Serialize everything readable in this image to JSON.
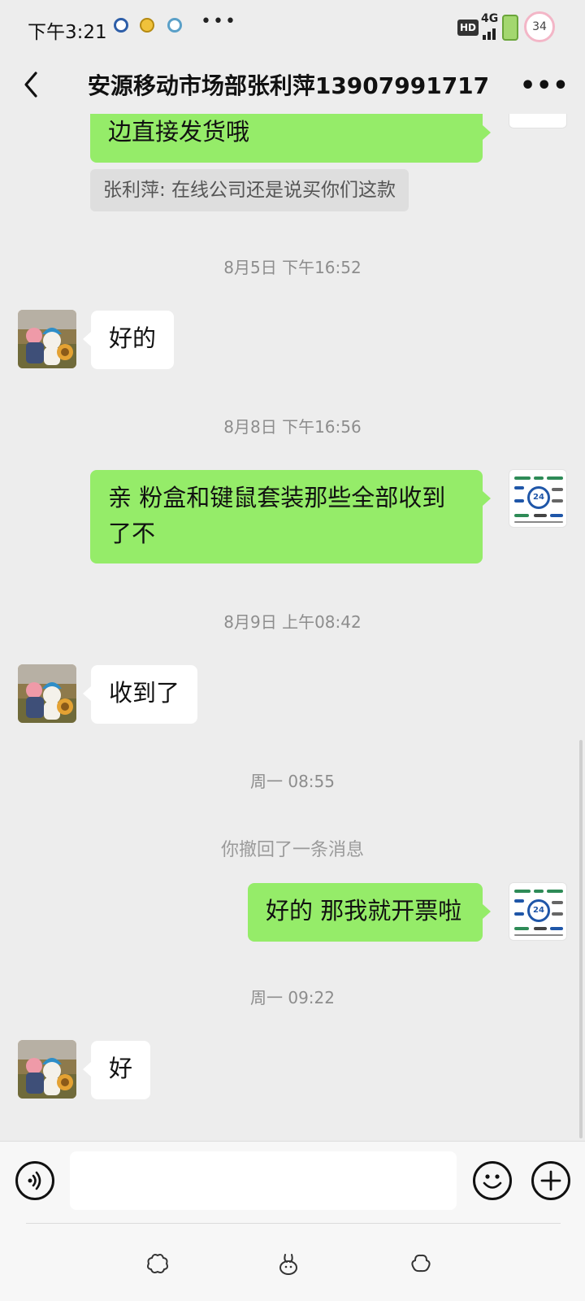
{
  "status_bar": {
    "time": "下午3:21",
    "hd_label": "HD",
    "network_label": "4G",
    "notification_count": "34"
  },
  "title_bar": {
    "title": "安源移动市场部张利萍13907991717",
    "more_glyph": "•••"
  },
  "messages": [
    {
      "type": "text",
      "side": "out",
      "text": "边直接发货哦"
    },
    {
      "type": "quote",
      "text": "张利萍: 在线公司还是说买你们这款"
    },
    {
      "type": "time",
      "text": "8月5日 下午16:52"
    },
    {
      "type": "text",
      "side": "in",
      "text": "好的"
    },
    {
      "type": "time",
      "text": "8月8日 下午16:56"
    },
    {
      "type": "text",
      "side": "out",
      "text": "亲 粉盒和键鼠套装那些全部收到了不"
    },
    {
      "type": "time",
      "text": "8月9日 上午08:42"
    },
    {
      "type": "text",
      "side": "in",
      "text": "收到了"
    },
    {
      "type": "time",
      "text": "周一 08:55"
    },
    {
      "type": "system",
      "text": "你撤回了一条消息"
    },
    {
      "type": "text",
      "side": "out",
      "text": "好的 那我就开票啦"
    },
    {
      "type": "time",
      "text": "周一 09:22"
    },
    {
      "type": "text",
      "side": "in",
      "text": "好"
    }
  ],
  "input_bar": {
    "value": "",
    "placeholder": ""
  },
  "colors": {
    "background": "#ededed",
    "outgoing_bubble": "#95ec69",
    "incoming_bubble": "#ffffff",
    "timestamp_text": "#8d8d8d"
  },
  "icons": {
    "back": "chevron-left-icon",
    "more": "more-dots-icon",
    "voice": "voice-input-icon",
    "emoji": "emoji-icon",
    "plus": "plus-icon",
    "bottom_left": "flower-icon",
    "bottom_center": "bunny-icon",
    "bottom_right": "flower-icon"
  }
}
